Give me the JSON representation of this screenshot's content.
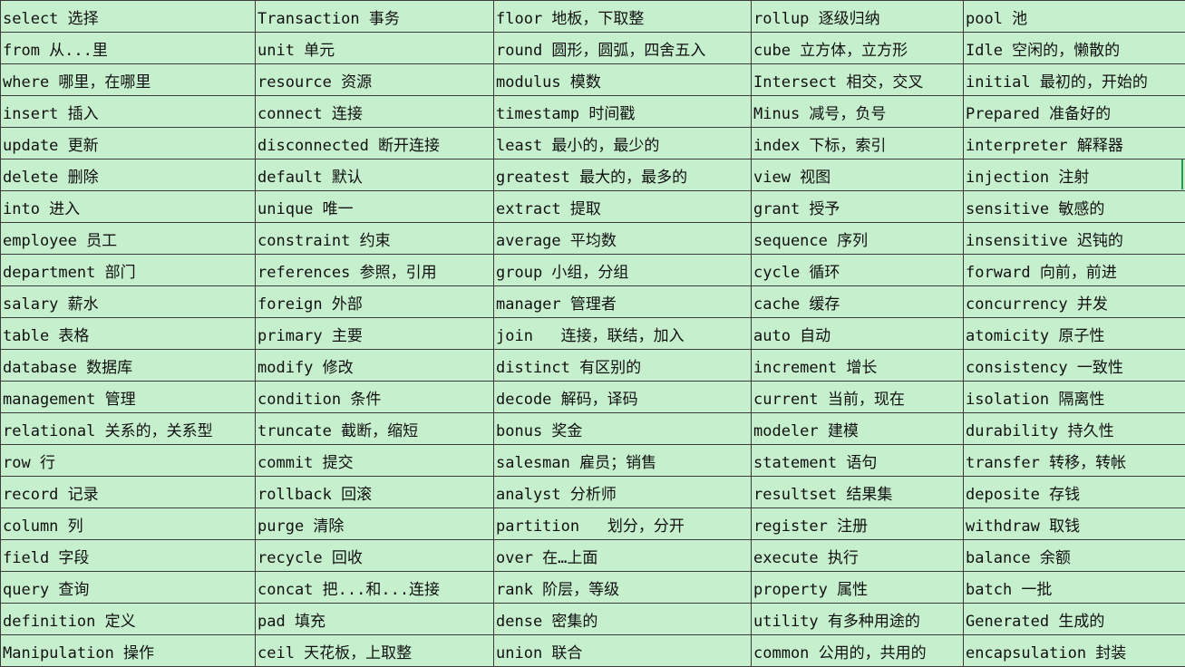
{
  "sheet": {
    "columns": 5,
    "colors": {
      "cell_background": "#c6efce",
      "grid_line": "#3c3c3c",
      "text": "#111111",
      "selection_mark": "#1f9d55"
    },
    "rows": [
      [
        "select 选择",
        "Transaction 事务",
        "floor 地板，下取整",
        "rollup 逐级归纳",
        "pool 池"
      ],
      [
        "from 从...里",
        "unit 单元",
        "round 圆形，圆弧，四舍五入",
        "cube 立方体，立方形",
        "Idle 空闲的，懒散的"
      ],
      [
        "where 哪里，在哪里",
        "resource 资源",
        "modulus 模数",
        "Intersect 相交，交叉",
        "initial 最初的，开始的"
      ],
      [
        "insert 插入",
        "connect 连接",
        "timestamp 时间戳",
        "Minus 减号，负号",
        "Prepared 准备好的"
      ],
      [
        "update 更新",
        "disconnected 断开连接",
        "least 最小的，最少的",
        "index 下标，索引",
        "interpreter 解释器"
      ],
      [
        "delete 删除",
        "default 默认",
        "greatest 最大的，最多的",
        "view 视图",
        "injection 注射"
      ],
      [
        "into 进入",
        "unique 唯一",
        "extract 提取",
        "grant 授予",
        "sensitive 敏感的"
      ],
      [
        "employee 员工",
        "constraint 约束",
        "average 平均数",
        "sequence 序列",
        "insensitive 迟钝的"
      ],
      [
        "department 部门",
        "references 参照，引用",
        "group 小组，分组",
        "cycle 循环",
        "forward 向前，前进"
      ],
      [
        "salary 薪水",
        "foreign 外部",
        "manager 管理者",
        "cache 缓存",
        "concurrency 并发"
      ],
      [
        "table 表格",
        "primary 主要",
        "join   连接，联结，加入",
        "auto 自动",
        "atomicity 原子性"
      ],
      [
        "database 数据库",
        "modify 修改",
        "distinct 有区别的",
        "increment 增长",
        "consistency 一致性"
      ],
      [
        "management 管理",
        "condition 条件",
        "decode 解码，译码",
        "current 当前，现在",
        "isolation 隔离性"
      ],
      [
        "relational 关系的，关系型",
        "truncate 截断，缩短",
        "bonus 奖金",
        "modeler 建模",
        "durability 持久性"
      ],
      [
        "row 行",
        "commit 提交",
        "salesman 雇员；销售",
        "statement 语句",
        "transfer 转移，转帐"
      ],
      [
        "record 记录",
        "rollback 回滚",
        "analyst 分析师",
        "resultset 结果集",
        "deposite 存钱"
      ],
      [
        "column 列",
        "purge 清除",
        "partition   划分，分开",
        "register 注册",
        "withdraw 取钱"
      ],
      [
        "field 字段",
        "recycle 回收",
        "over 在…上面",
        "execute 执行",
        "balance 余额"
      ],
      [
        "query 查询",
        "concat 把...和...连接",
        "rank 阶层，等级",
        "property 属性",
        "batch 一批"
      ],
      [
        "definition 定义",
        "pad 填充",
        "dense 密集的",
        "utility 有多种用途的",
        "Generated 生成的"
      ],
      [
        "Manipulation 操作",
        "ceil 天花板，上取整",
        "union 联合",
        "common 公用的，共用的",
        "encapsulation 封装"
      ]
    ]
  }
}
